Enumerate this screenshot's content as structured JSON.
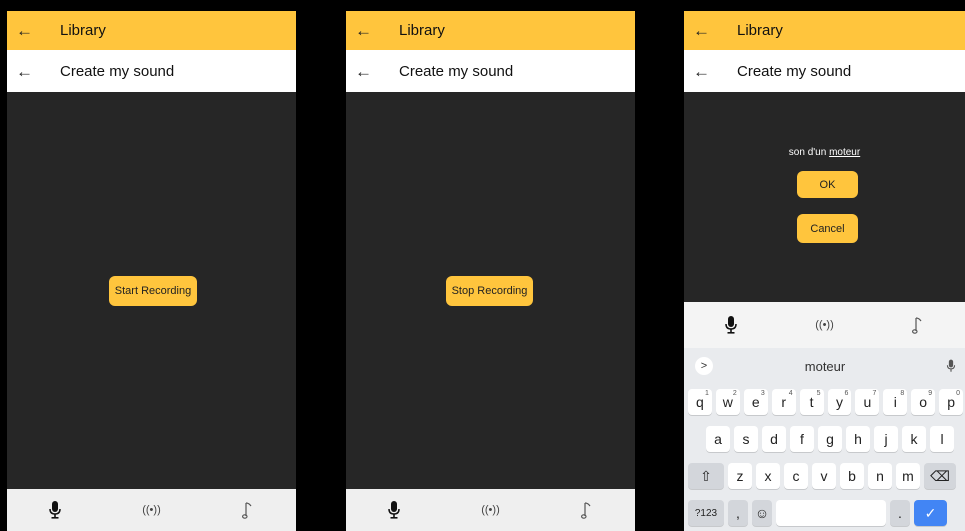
{
  "header": {
    "title": "Library",
    "back_icon": "←"
  },
  "subheader": {
    "title": "Create my sound",
    "back_icon": "←"
  },
  "screen1": {
    "button": "Start Recording"
  },
  "screen2": {
    "button": "Stop Recording"
  },
  "screen3": {
    "dialog_prefix": "son d'un ",
    "dialog_word": "moteur",
    "ok": "OK",
    "cancel": "Cancel"
  },
  "bottom_nav": {
    "icons": [
      "microphone-icon",
      "broadcast-icon",
      "music-note-icon"
    ],
    "broadcast_glyph": "((•))"
  },
  "keyboard": {
    "suggestion": "moteur",
    "suggestion_arrow": ">",
    "row1": [
      "q",
      "w",
      "e",
      "r",
      "t",
      "y",
      "u",
      "i",
      "o",
      "p"
    ],
    "row1_hints": [
      "1",
      "2",
      "3",
      "4",
      "5",
      "6",
      "7",
      "8",
      "9",
      "0"
    ],
    "row2": [
      "a",
      "s",
      "d",
      "f",
      "g",
      "h",
      "j",
      "k",
      "l"
    ],
    "row3": [
      "z",
      "x",
      "c",
      "v",
      "b",
      "n",
      "m"
    ],
    "shift": "⇧",
    "backspace": "⌫",
    "numbers": "?123",
    "comma": ",",
    "emoji": "☺",
    "period": ".",
    "enter": "✓"
  },
  "colors": {
    "accent": "#ffc53d",
    "dark_bg": "#262626",
    "enter_key": "#4285f4"
  }
}
